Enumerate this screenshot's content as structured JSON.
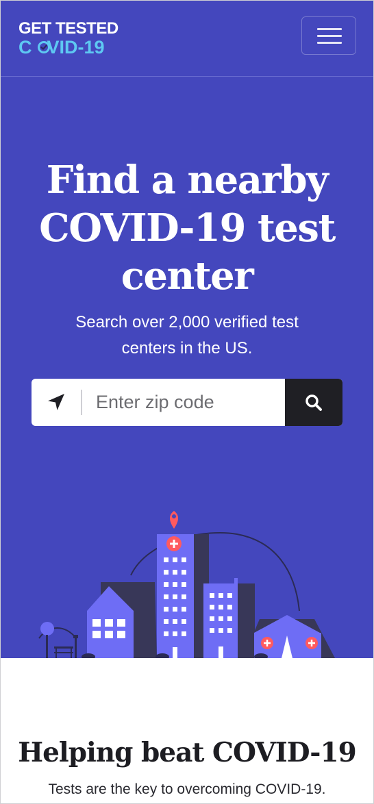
{
  "brand": {
    "line1": "GET TESTED",
    "line2_prefix": "C",
    "line2_suffix": "VID-19",
    "colors": {
      "primary": "#4447bd",
      "accent": "#5ec8f2",
      "dark": "#1f1f24",
      "pin": "#ff5a5f"
    }
  },
  "nav": {
    "menu_icon": "hamburger-menu-icon"
  },
  "hero": {
    "title_line1": "Find a nearby",
    "title_line2": "COVID-19 test",
    "title_line3": "center",
    "subtitle_line1": "Search over 2,000 verified test",
    "subtitle_line2": "centers in the US."
  },
  "search": {
    "placeholder": "Enter zip code",
    "value": "",
    "location_icon": "location-arrow-icon",
    "search_icon": "search-icon"
  },
  "section2": {
    "title": "Helping beat COVID-19",
    "subtitle": "Tests are the key to overcoming COVID-19."
  }
}
